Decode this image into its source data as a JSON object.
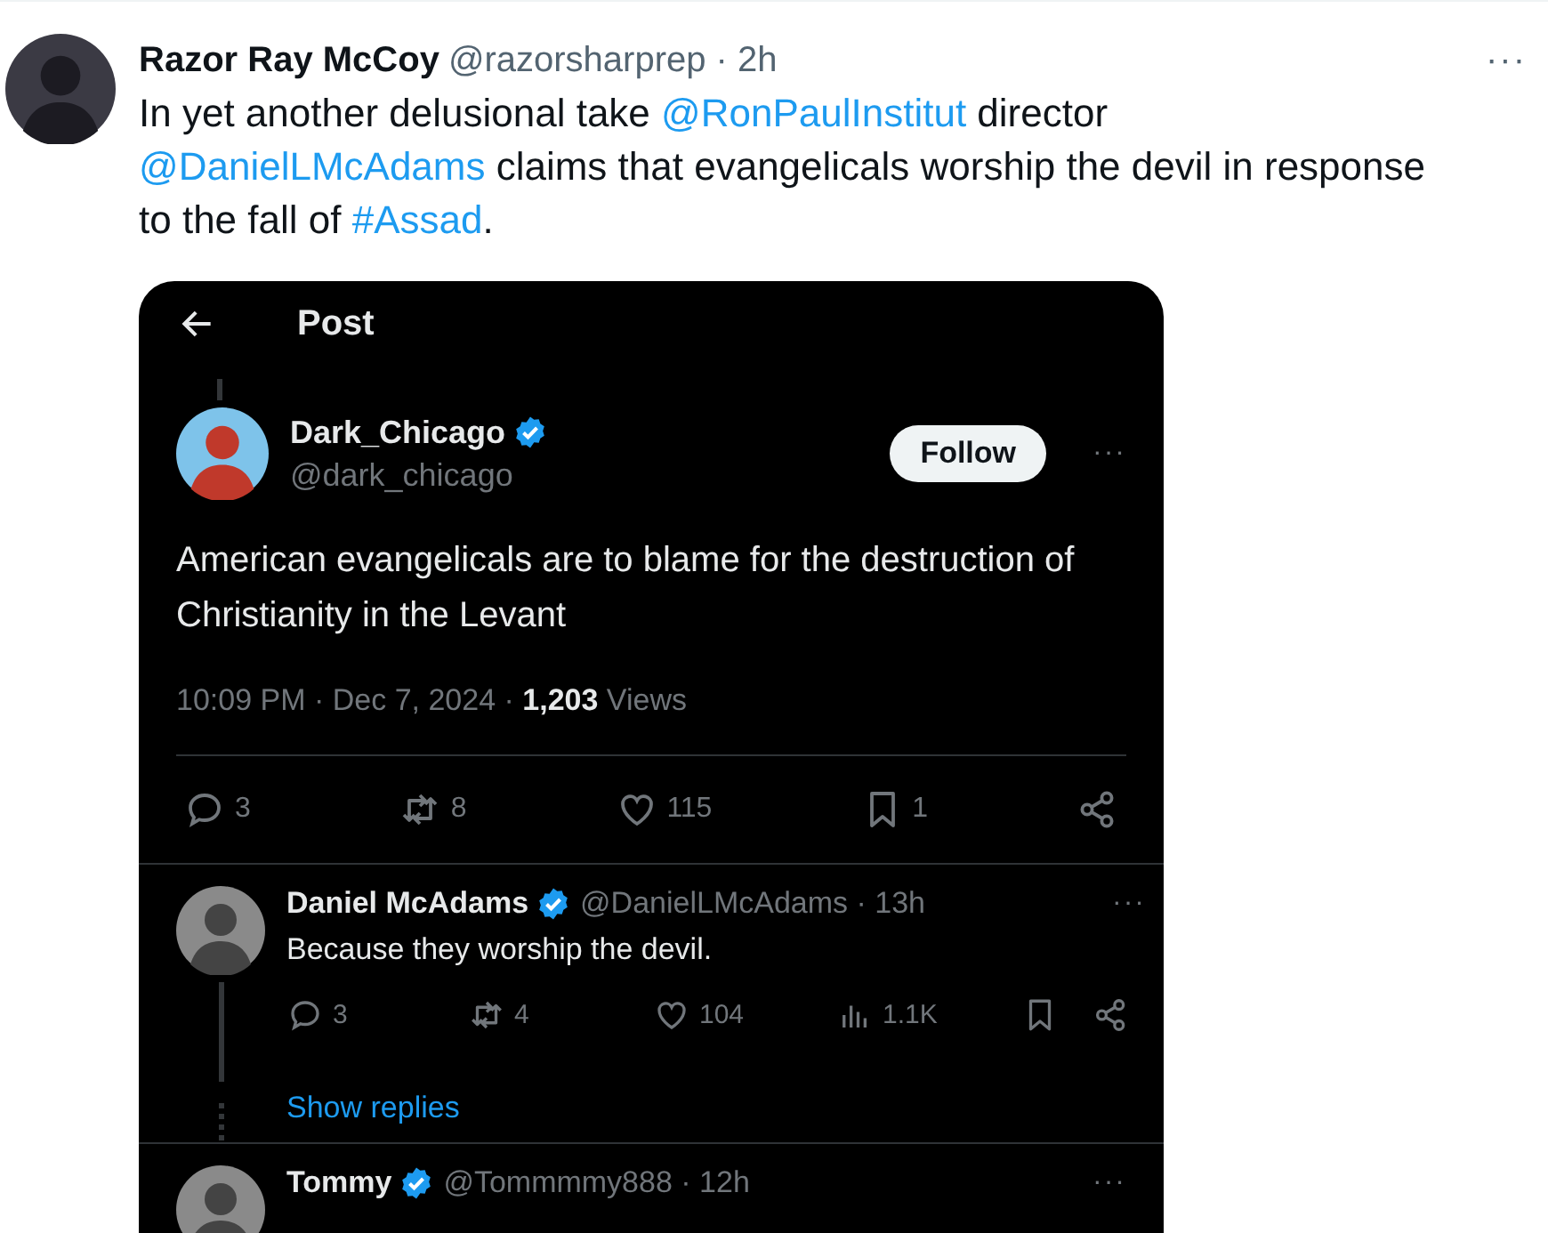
{
  "post": {
    "author": "Razor Ray McCoy",
    "handle": "@razorsharprep · 2h",
    "more": "···",
    "text": [
      {
        "kind": "plain",
        "text": "In yet another delusional take "
      },
      {
        "kind": "link",
        "text": "@RonPaulInstitut"
      },
      {
        "kind": "plain",
        "text": " director "
      },
      {
        "kind": "link",
        "text": "@DanielLMcAdams"
      },
      {
        "kind": "plain",
        "text": " claims that evangelicals worship the devil in response to the fall of "
      },
      {
        "kind": "link",
        "text": "#Assad"
      },
      {
        "kind": "plain",
        "text": "."
      }
    ]
  },
  "screenshot": {
    "header": {
      "title": "Post"
    },
    "tweet": {
      "name": "Dark_Chicago",
      "verified": true,
      "handle": "@dark_chicago",
      "follow": "Follow",
      "more": "···",
      "text": "American evangelicals are to blame for the destruction of Christianity in the Levant",
      "meta": "10:09 PM · Dec 7, 2024 · **1,203** Views",
      "actions": [
        {
          "kind": "reply",
          "count": "3"
        },
        {
          "kind": "repost",
          "count": "8"
        },
        {
          "kind": "like",
          "count": "115"
        },
        {
          "kind": "bookmark",
          "count": "1"
        },
        {
          "kind": "share"
        }
      ]
    },
    "replies": [
      {
        "name": "Daniel McAdams",
        "verified": true,
        "handle": "@DanielLMcAdams · 13h",
        "more": "···",
        "text": "Because they worship the devil.",
        "actions": [
          {
            "kind": "reply",
            "count": "3"
          },
          {
            "kind": "repost",
            "count": "4"
          },
          {
            "kind": "like",
            "count": "104"
          },
          {
            "kind": "views",
            "count": "1.1K"
          },
          {
            "kind": "bookmark"
          },
          {
            "kind": "share"
          }
        ],
        "show_replies": "Show replies"
      },
      {
        "name": "Tommy",
        "verified": true,
        "handle": "@Tommmmy888 · 12h",
        "more": "···"
      }
    ]
  }
}
